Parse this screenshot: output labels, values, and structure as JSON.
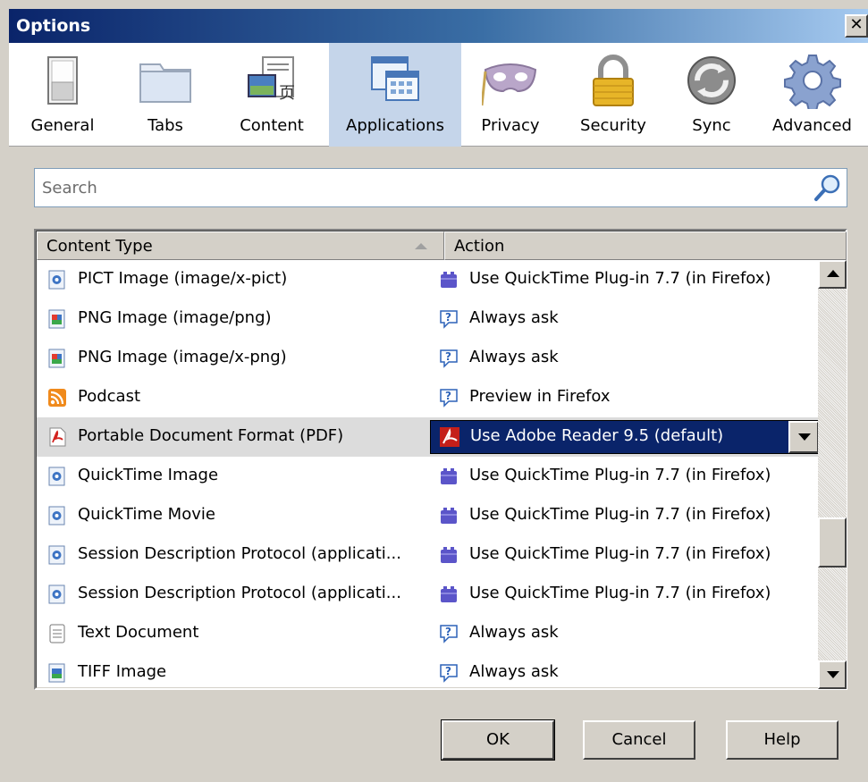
{
  "window": {
    "title": "Options",
    "close_label": "✕"
  },
  "toolbar": {
    "items": [
      {
        "label": "General",
        "icon": "general-switch-icon"
      },
      {
        "label": "Tabs",
        "icon": "tabs-folder-icon"
      },
      {
        "label": "Content",
        "icon": "content-icon"
      },
      {
        "label": "Applications",
        "icon": "applications-icon",
        "selected": true
      },
      {
        "label": "Privacy",
        "icon": "privacy-mask-icon"
      },
      {
        "label": "Security",
        "icon": "security-lock-icon"
      },
      {
        "label": "Sync",
        "icon": "sync-icon"
      },
      {
        "label": "Advanced",
        "icon": "advanced-gear-icon"
      }
    ]
  },
  "search": {
    "placeholder": "Search"
  },
  "table": {
    "headers": {
      "content_type": "Content Type",
      "action": "Action"
    },
    "rows": [
      {
        "type": "PICT Image (image/x-pict)",
        "type_icon": "quicktime-file-icon",
        "action": "Use QuickTime Plug-in 7.7 (in Firefox)",
        "action_icon": "plugin-icon"
      },
      {
        "type": "PNG Image (image/png)",
        "type_icon": "image-file-icon",
        "action": "Always ask",
        "action_icon": "ask-icon"
      },
      {
        "type": "PNG Image (image/x-png)",
        "type_icon": "image-file-icon",
        "action": "Always ask",
        "action_icon": "ask-icon"
      },
      {
        "type": "Podcast",
        "type_icon": "feed-icon",
        "action": "Preview in Firefox",
        "action_icon": "ask-icon"
      },
      {
        "type": "Portable Document Format (PDF)",
        "type_icon": "pdf-file-icon",
        "action": "Use Adobe Reader 9.5 (default)",
        "action_icon": "adobe-reader-icon",
        "selected": true
      },
      {
        "type": "QuickTime Image",
        "type_icon": "quicktime-file-icon",
        "action": "Use QuickTime Plug-in 7.7 (in Firefox)",
        "action_icon": "plugin-icon"
      },
      {
        "type": "QuickTime Movie",
        "type_icon": "quicktime-file-icon",
        "action": "Use QuickTime Plug-in 7.7 (in Firefox)",
        "action_icon": "plugin-icon"
      },
      {
        "type": "Session Description Protocol (applicati...",
        "type_icon": "quicktime-file-icon",
        "action": "Use QuickTime Plug-in 7.7 (in Firefox)",
        "action_icon": "plugin-icon"
      },
      {
        "type": "Session Description Protocol (applicati...",
        "type_icon": "quicktime-file-icon",
        "action": "Use QuickTime Plug-in 7.7 (in Firefox)",
        "action_icon": "plugin-icon"
      },
      {
        "type": "Text Document",
        "type_icon": "text-file-icon",
        "action": "Always ask",
        "action_icon": "ask-icon"
      },
      {
        "type": "TIFF Image",
        "type_icon": "image-file-icon",
        "action": "Always ask",
        "action_icon": "ask-icon"
      }
    ]
  },
  "buttons": {
    "ok": "OK",
    "cancel": "Cancel",
    "help": "Help"
  },
  "colors": {
    "title_start": "#0a246a",
    "title_end": "#a6caf0",
    "selection": "#0a246a",
    "toolbar_selected": "#c5d5ea"
  }
}
